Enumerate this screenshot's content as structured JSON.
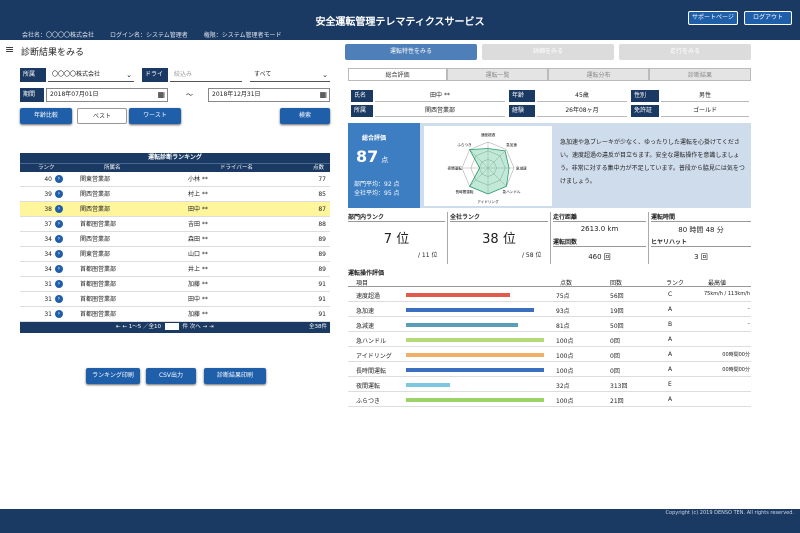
{
  "app": {
    "title": "安全運転管理テレマティクスサービス",
    "company": "会社名：〇〇〇〇株式会社",
    "login": "ログイン名：システム管理者",
    "mode": "権限：システム管理者モード",
    "support_label": "サポートページ",
    "logout_label": "ログアウト",
    "copyright": "Copyright (c) 2019 DENSO TEN. All rights reserved."
  },
  "page": {
    "title": "診断結果をみる"
  },
  "filters": {
    "shozoku_label": "所属",
    "shozoku_value": "〇〇〇〇株式会社",
    "driver_label": "ドライバー",
    "driver_placeholder": "絞込み",
    "driver_value": "すべて",
    "period_label": "期間",
    "date_from": "2018年07月01日",
    "tilde": "～",
    "date_to": "2018年12月31日"
  },
  "buttons": {
    "compare": "年齢比較",
    "best": "ベスト",
    "worst": "ワースト",
    "search": "検索",
    "print_ranking": "ランキング印刷",
    "csv": "CSV出力",
    "print_result": "診断結果印刷"
  },
  "ranking": {
    "caption": "運転診断ランキング",
    "headers": {
      "rank": "ランク",
      "dept": "所属名",
      "driver": "ドライバー名",
      "score": "点数"
    },
    "rows": [
      {
        "rank": "40",
        "dept": "関東営業部",
        "driver": "小林 **",
        "score": "77"
      },
      {
        "rank": "39",
        "dept": "関西営業部",
        "driver": "村上 **",
        "score": "85"
      },
      {
        "rank": "38",
        "dept": "関西営業部",
        "driver": "田中 **",
        "score": "87"
      },
      {
        "rank": "37",
        "dept": "首都圏営業部",
        "driver": "吉田 **",
        "score": "88"
      },
      {
        "rank": "34",
        "dept": "関西営業部",
        "driver": "森田 **",
        "score": "89"
      },
      {
        "rank": "34",
        "dept": "関東営業部",
        "driver": "山口 **",
        "score": "89"
      },
      {
        "rank": "34",
        "dept": "首都圏営業部",
        "driver": "井上 **",
        "score": "89"
      },
      {
        "rank": "31",
        "dept": "首都圏営業部",
        "driver": "加藤 **",
        "score": "91"
      },
      {
        "rank": "31",
        "dept": "首都圏営業部",
        "driver": "田中 **",
        "score": "91"
      },
      {
        "rank": "31",
        "dept": "首都圏営業部",
        "driver": "加藤 **",
        "score": "91"
      }
    ],
    "pager": {
      "first": "⇤",
      "prev": "←",
      "range": "1～5 ／全10",
      "page_suffix": "件 次へ",
      "next": "→",
      "last": "⇥",
      "total": "全38件"
    }
  },
  "tabs": {
    "main": [
      "運転特性をみる",
      "詳細をみる",
      "走行をみる"
    ],
    "sub": [
      "総合評価",
      "運転一覧",
      "運転分布",
      "診断結果"
    ]
  },
  "info": {
    "name_label": "氏名",
    "name_value": "田中 **",
    "age_label": "年齢",
    "age_value": "45歳",
    "gender_label": "性別",
    "gender_value": "男性",
    "dept_label": "所属",
    "dept_value": "関西営業部",
    "exp_label": "経験",
    "exp_value": "26年08ヶ月",
    "license_label": "免許証",
    "license_value": "ゴールド"
  },
  "overall": {
    "heading": "総合評価",
    "score": "87",
    "unit": "点",
    "dept_avg": "部門平均：92 点",
    "company_avg": "全社平均：95 点",
    "comment": "急加速や急ブレーキが少なく、ゆったりした運転を心掛けてください。速度超過の違反が目立ちます。安全な運転操作を意識しましょう。非常に対する集中力が不足しています。普段から脇見には気をつけましょう。"
  },
  "radar": {
    "labels": [
      "速度超過",
      "急加速",
      "急減速",
      "急ハンドル",
      "アイドリング",
      "長時間運転",
      "夜間運転",
      "ふらつき"
    ]
  },
  "stats": {
    "dept_rank_label": "部門内ランク",
    "dept_rank": "7 位",
    "dept_total": "/ 11 位",
    "company_rank_label": "全社ランク",
    "company_rank": "38 位",
    "company_total": "/ 58 位",
    "distance_label": "走行距離",
    "distance": "2613.0 km",
    "time_label": "運転時間",
    "time": "80 時間 48 分",
    "count_label": "運転回数",
    "count": "460 回",
    "hiyari_label": "ヒヤリハット",
    "hiyari": "3 回"
  },
  "evaluation": {
    "title": "運転操作評価",
    "headers": {
      "item": "項目",
      "score": "点数",
      "count": "回数",
      "rank": "ランク",
      "max": "最高値"
    },
    "rows": [
      {
        "item": "速度超過",
        "score": "75点",
        "count": "56回",
        "rank": "C",
        "max": "75km/h / 113km/h",
        "ratio": 0.75,
        "color": "#e05a4e"
      },
      {
        "item": "急加速",
        "score": "93点",
        "count": "19回",
        "rank": "A",
        "max": "–",
        "ratio": 0.93,
        "color": "#3a6fbf"
      },
      {
        "item": "急減速",
        "score": "81点",
        "count": "50回",
        "rank": "B",
        "max": "–",
        "ratio": 0.81,
        "color": "#5a9fb8"
      },
      {
        "item": "急ハンドル",
        "score": "100点",
        "count": "0回",
        "rank": "A",
        "max": "",
        "ratio": 1.0,
        "color": "#b6d97a"
      },
      {
        "item": "アイドリング",
        "score": "100点",
        "count": "0回",
        "rank": "A",
        "max": "00時間00分",
        "ratio": 1.0,
        "color": "#f0b06a"
      },
      {
        "item": "長時間運転",
        "score": "100点",
        "count": "0回",
        "rank": "A",
        "max": "00時間00分",
        "ratio": 1.0,
        "color": "#3a6fbf"
      },
      {
        "item": "夜間運転",
        "score": "32点",
        "count": "313回",
        "rank": "E",
        "max": "",
        "ratio": 0.32,
        "color": "#7ec7e0"
      },
      {
        "item": "ふらつき",
        "score": "100点",
        "count": "21回",
        "rank": "A",
        "max": "",
        "ratio": 1.0,
        "color": "#9bd36a"
      }
    ]
  }
}
